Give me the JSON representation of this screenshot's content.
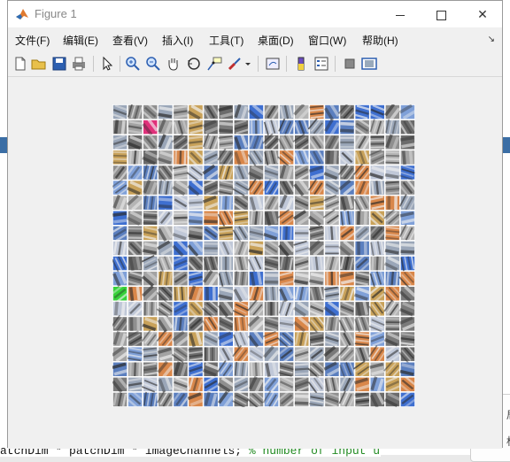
{
  "window": {
    "title": "Figure 1",
    "minimize_icon": "minimize-icon",
    "maximize_icon": "maximize-icon",
    "close_glyph": "✕"
  },
  "menu": [
    "文件(F)",
    "编辑(E)",
    "查看(V)",
    "插入(I)",
    "工具(T)",
    "桌面(D)",
    "窗口(W)",
    "帮助(H)"
  ],
  "toolbar_icons": [
    "new-figure-icon",
    "open-file-icon",
    "save-icon",
    "print-icon",
    "select-arrow-icon",
    "zoom-in-icon",
    "zoom-out-icon",
    "pan-hand-icon",
    "rotate-3d-icon",
    "data-cursor-icon",
    "brush-icon",
    "brush-dropdown-icon",
    "link-plot-icon",
    "insert-colorbar-icon",
    "insert-legend-icon",
    "hide-plot-tools-icon",
    "show-plot-tools-icon"
  ],
  "figure": {
    "grid_rows": 20,
    "grid_cols": 20,
    "palette": [
      "#8f8f8f",
      "#a3a3a3",
      "#7a7a7a",
      "#b5b5b5",
      "#6b6b6b",
      "#9aa6b8",
      "#5b7fbf",
      "#3e6fd0",
      "#c9a25a",
      "#d9874a",
      "#7fa0d8",
      "#c0c8d8"
    ],
    "accent_green": "#37d23a",
    "accent_magenta": "#e0307a"
  },
  "background": {
    "bottom_code": "atchDim * patchDim * imageChannels;",
    "bottom_comment": "% number of input units",
    "popup_text": "局",
    "popup_text2": "标"
  }
}
